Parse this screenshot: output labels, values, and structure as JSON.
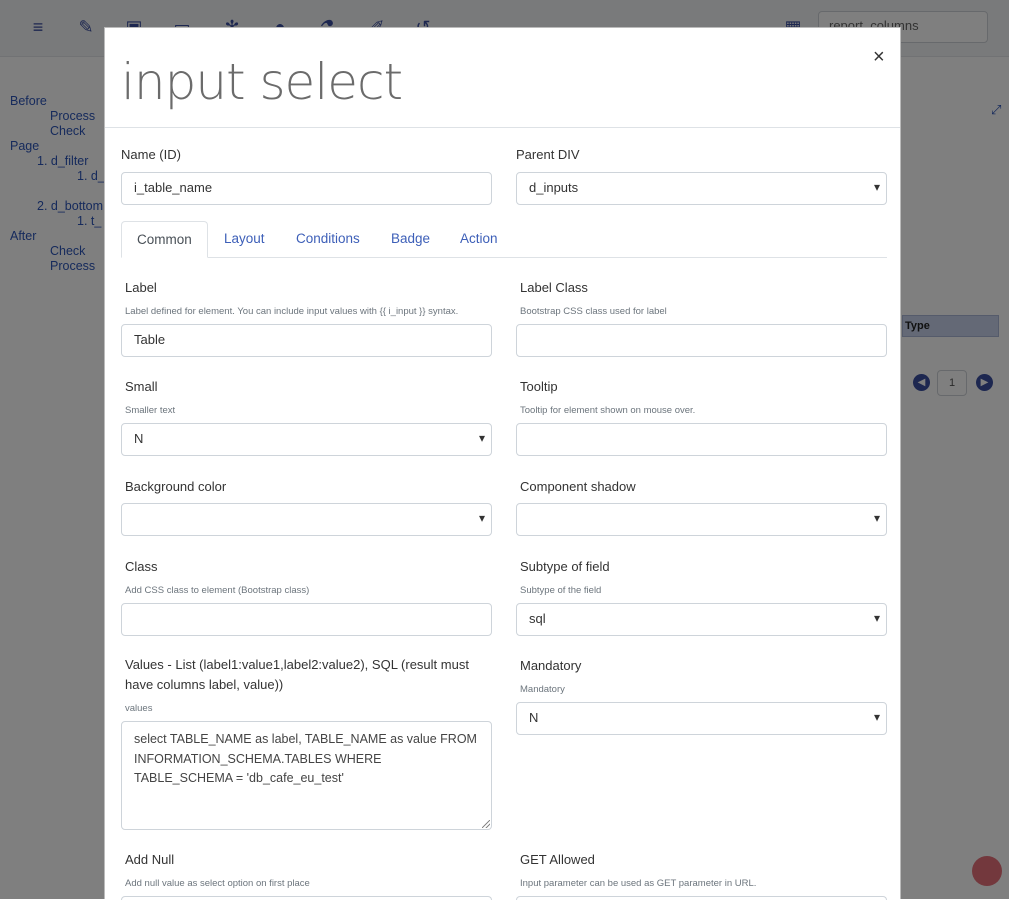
{
  "background": {
    "search_value": "report_columns",
    "tree": [
      "Before",
      "Process",
      "Check",
      "Page",
      "1. d_filter",
      "1. d_",
      "2. d_bottom",
      "1. t_",
      "After",
      "Check",
      "Process"
    ],
    "table_header": "Type",
    "page_number": "1"
  },
  "modal": {
    "title": "input select",
    "close": "×",
    "name_label": "Name (ID)",
    "name_value": "i_table_name",
    "parent_label": "Parent DIV",
    "parent_value": "d_inputs",
    "tabs": [
      "Common",
      "Layout",
      "Conditions",
      "Badge",
      "Action"
    ],
    "fields": {
      "label": {
        "label": "Label",
        "hint": "Label defined for element. You can include input values with {{ i_input }} syntax.",
        "value": "Table"
      },
      "label_class": {
        "label": "Label Class",
        "hint": "Bootstrap CSS class used for label",
        "value": ""
      },
      "small": {
        "label": "Small",
        "hint": "Smaller text",
        "value": "N"
      },
      "tooltip": {
        "label": "Tooltip",
        "hint": "Tooltip for element shown on mouse over.",
        "value": ""
      },
      "bg_color": {
        "label": "Background color",
        "value": ""
      },
      "shadow": {
        "label": "Component shadow",
        "value": ""
      },
      "class": {
        "label": "Class",
        "hint": "Add CSS class to element (Bootstrap class)",
        "value": ""
      },
      "subtype": {
        "label": "Subtype of field",
        "hint": "Subtype of the field",
        "value": "sql"
      },
      "values": {
        "label": "Values - List (label1:value1,label2:value2), SQL (result must have columns label, value))",
        "hint": "values",
        "value": "select TABLE_NAME as label, TABLE_NAME as value FROM INFORMATION_SCHEMA.TABLES WHERE TABLE_SCHEMA = 'db_cafe_eu_test'"
      },
      "mandatory": {
        "label": "Mandatory",
        "hint": "Mandatory",
        "value": "N"
      },
      "add_null": {
        "label": "Add Null",
        "hint": "Add null value as select option on first place"
      },
      "get_allowed": {
        "label": "GET Allowed",
        "hint": "Input parameter can be used as GET parameter in URL."
      }
    }
  }
}
